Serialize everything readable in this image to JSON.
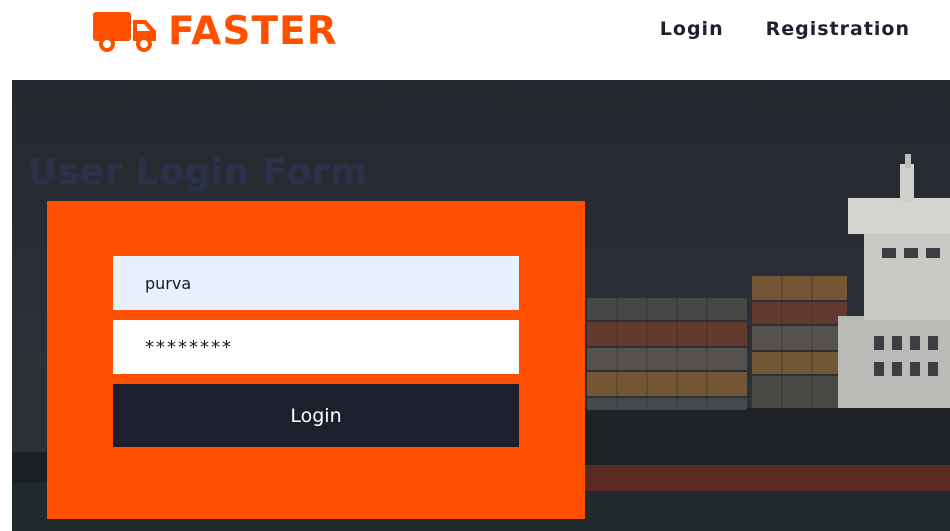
{
  "header": {
    "brand_name": "FASTER",
    "nav": {
      "login_label": "Login",
      "registration_label": "Registration"
    }
  },
  "hero": {
    "title": "User Login Form"
  },
  "login_form": {
    "username_value": "purva",
    "password_value": "********",
    "submit_label": "Login"
  },
  "colors": {
    "brand_orange": "#ff5000",
    "form_background": "#fe5000",
    "button_dark": "#1d1f2d",
    "hero_dark": "#262a31",
    "autofill_blue": "#e8f0fe"
  },
  "icons": {
    "logo": "truck-icon"
  }
}
